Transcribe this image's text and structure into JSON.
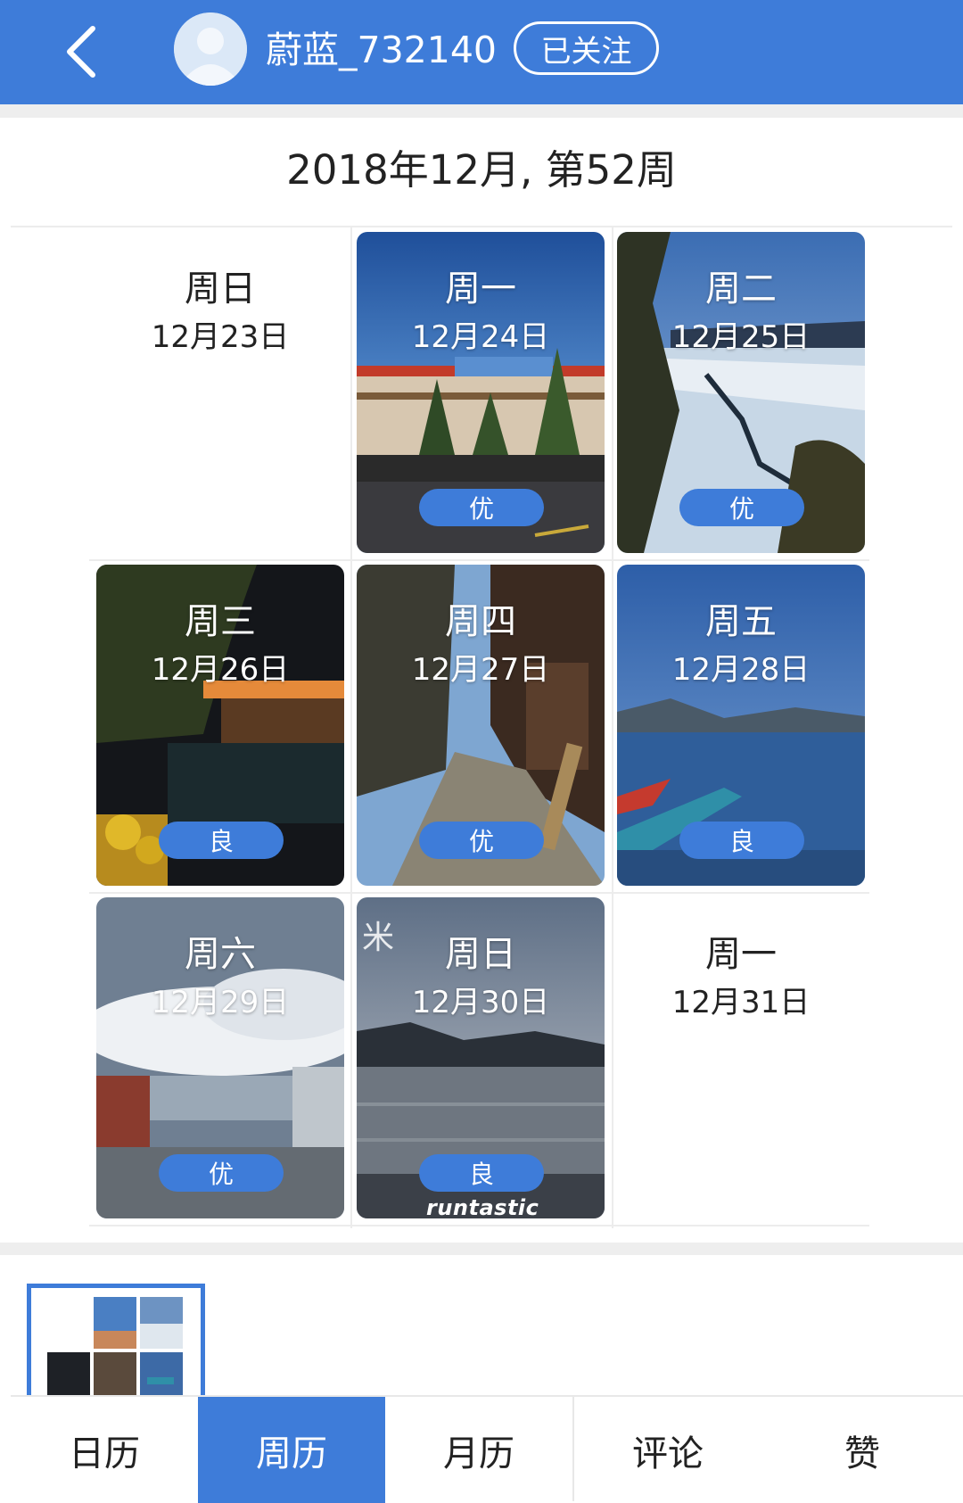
{
  "header": {
    "username": "蔚蓝_732140",
    "follow_label": "已关注"
  },
  "week_title": "2018年12月, 第52周",
  "days": [
    {
      "day": "周日",
      "date": "12月23日",
      "grade": ""
    },
    {
      "day": "周一",
      "date": "12月24日",
      "grade": "优"
    },
    {
      "day": "周二",
      "date": "12月25日",
      "grade": "优"
    },
    {
      "day": "周三",
      "date": "12月26日",
      "grade": "良"
    },
    {
      "day": "周四",
      "date": "12月27日",
      "grade": "优"
    },
    {
      "day": "周五",
      "date": "12月28日",
      "grade": "良"
    },
    {
      "day": "周六",
      "date": "12月29日",
      "grade": "优"
    },
    {
      "day": "周日",
      "date": "12月30日",
      "grade": "良",
      "watermark": "runtastic"
    },
    {
      "day": "周一",
      "date": "12月31日",
      "grade": ""
    }
  ],
  "tabs": [
    {
      "label": "日历",
      "active": false
    },
    {
      "label": "周历",
      "active": true
    },
    {
      "label": "月历",
      "active": false
    },
    {
      "label": "评论",
      "active": false
    },
    {
      "label": "赞",
      "active": false
    }
  ],
  "colors": {
    "brand_blue": "#3e7cd9",
    "divider": "#ececec"
  },
  "icons": {
    "back": "chevron-left-icon",
    "avatar": "user-avatar-icon"
  }
}
